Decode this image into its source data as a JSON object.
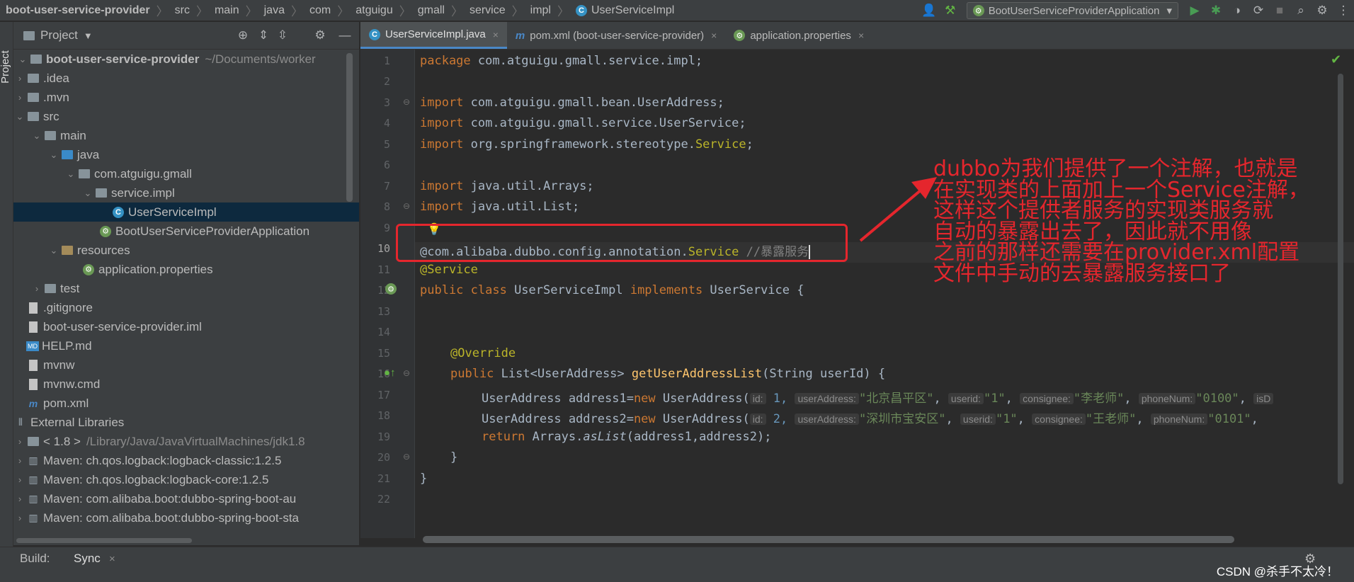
{
  "breadcrumb": [
    "boot-user-service-provider",
    "src",
    "main",
    "java",
    "com",
    "atguigu",
    "gmall",
    "service",
    "impl",
    "UserServiceImpl"
  ],
  "run_config": "BootUserServiceProviderApplication",
  "side_label": "Project",
  "project_panel_title": "Project",
  "tree": [
    {
      "label": "boot-user-service-provider",
      "extra": "~/Documents/worker"
    },
    {
      "label": ".idea"
    },
    {
      "label": ".mvn"
    },
    {
      "label": "src"
    },
    {
      "label": "main"
    },
    {
      "label": "java"
    },
    {
      "label": "com.atguigu.gmall"
    },
    {
      "label": "service.impl"
    },
    {
      "label": "UserServiceImpl"
    },
    {
      "label": "BootUserServiceProviderApplication"
    },
    {
      "label": "resources"
    },
    {
      "label": "application.properties"
    },
    {
      "label": "test"
    },
    {
      "label": ".gitignore"
    },
    {
      "label": "boot-user-service-provider.iml"
    },
    {
      "label": "HELP.md"
    },
    {
      "label": "mvnw"
    },
    {
      "label": "mvnw.cmd"
    },
    {
      "label": "pom.xml"
    },
    {
      "label": "External Libraries"
    },
    {
      "label": "< 1.8 >",
      "extra": "/Library/Java/JavaVirtualMachines/jdk1.8"
    },
    {
      "label": "Maven: ch.qos.logback:logback-classic:1.2.5"
    },
    {
      "label": "Maven: ch.qos.logback:logback-core:1.2.5"
    },
    {
      "label": "Maven: com.alibaba.boot:dubbo-spring-boot-au"
    },
    {
      "label": "Maven: com.alibaba.boot:dubbo-spring-boot-sta"
    }
  ],
  "tabs": [
    "UserServiceImpl.java",
    "pom.xml (boot-user-service-provider)",
    "application.properties"
  ],
  "line_numbers": [
    "1",
    "2",
    "3",
    "4",
    "5",
    "6",
    "7",
    "8",
    "9",
    "10",
    "11",
    "12",
    "13",
    "14",
    "15",
    "16",
    "17",
    "18",
    "19",
    "20",
    "21",
    "22"
  ],
  "code": {
    "l1_kw": "package",
    "l1_rest": " com.atguigu.gmall.service.impl;",
    "l3_kw": "import",
    "l3_rest": " com.atguigu.gmall.bean.UserAddress;",
    "l4_kw": "import",
    "l4_rest": " com.atguigu.gmall.service.UserService;",
    "l5_kw": "import",
    "l5_rest": " org.springframework.stereotype.",
    "l5_svc": "Service",
    "l7_kw": "import",
    "l7_rest": " java.util.Arrays;",
    "l8_kw": "import",
    "l8_rest": " java.util.List;",
    "l10_a": "@com.alibaba.dubbo.config.annotation.",
    "l10_svc": "Service",
    "l10_cm": " //暴露服务",
    "l11": "@Service",
    "l12_kw1": "public class",
    "l12_mid": " UserServiceImpl ",
    "l12_kw2": "implements",
    "l12_rest": " UserService {",
    "l15": "@Override",
    "l16_kw": "public",
    "l16_mid": " List<UserAddress> ",
    "l16_fn": "getUserAddressList",
    "l16_rest": "(String userId) {",
    "l17_a": "UserAddress address1=",
    "l17_new": "new",
    "l17_b": " UserAddress(",
    "l17_h1": "id:",
    "l17_v1": " 1, ",
    "l17_h2": "userAddress:",
    "l17_v2": "\"北京昌平区\"",
    "l17_c1": ", ",
    "l17_h3": "userid:",
    "l17_v3": "\"1\"",
    "l17_c2": ", ",
    "l17_h4": "consignee:",
    "l17_v4": "\"李老师\"",
    "l17_c3": ", ",
    "l17_h5": "phoneNum:",
    "l17_v5": "\"0100\"",
    "l17_c4": ", ",
    "l17_h6": "isD",
    "l18_a": "UserAddress address2=",
    "l18_new": "new",
    "l18_b": " UserAddress(",
    "l18_h1": "id:",
    "l18_v1": " 2, ",
    "l18_h2": "userAddress:",
    "l18_v2": "\"深圳市宝安区\"",
    "l18_c1": ", ",
    "l18_h3": "userid:",
    "l18_v3": "\"1\"",
    "l18_c2": ", ",
    "l18_h4": "consignee:",
    "l18_v4": "\"王老师\"",
    "l18_c3": ", ",
    "l18_h5": "phoneNum:",
    "l18_v5": "\"0101\"",
    "l18_c4": ", ",
    "l19_kw": "return",
    "l19_a": " Arrays.",
    "l19_it": "asList",
    "l19_b": "(address1,address2);",
    "l20": "}",
    "l21": "}"
  },
  "annotation": [
    "dubbo为我们提供了一个注解，也就是",
    "在实现类的上面加上一个Service注解，",
    "这样这个提供者服务的实现类服务就",
    "自动的暴露出去了，因此就不用像",
    "之前的那样还需要在provider.xml配置",
    "文件中手动的去暴露服务接口了"
  ],
  "bottom": {
    "build_label": "Build:",
    "sync_tab": "Sync",
    "sync_close": "×"
  },
  "watermark": "CSDN @杀手不太冷！",
  "colors": {
    "keyword": "#cc7832",
    "annotation": "#bbb529",
    "string": "#6a8759",
    "comment": "#808080",
    "red_note": "#e5262d"
  }
}
